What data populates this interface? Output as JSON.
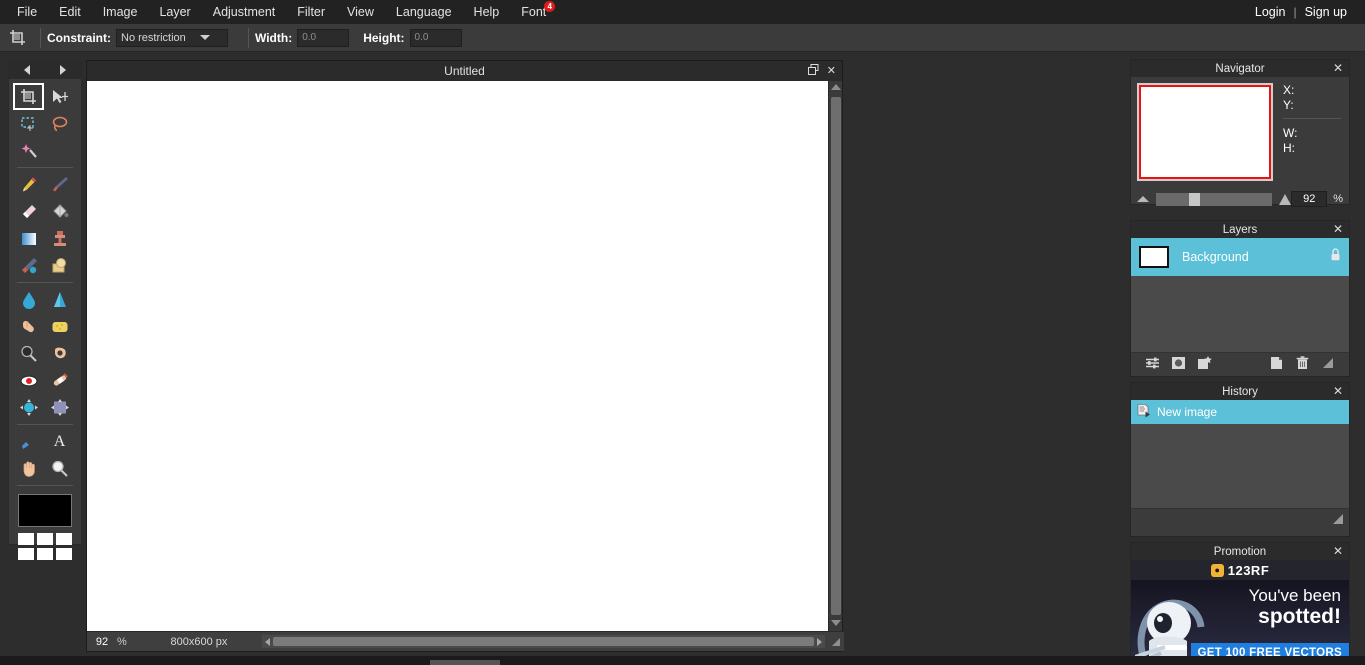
{
  "menubar": {
    "items": [
      {
        "label": "File"
      },
      {
        "label": "Edit"
      },
      {
        "label": "Image"
      },
      {
        "label": "Layer"
      },
      {
        "label": "Adjustment"
      },
      {
        "label": "Filter"
      },
      {
        "label": "View"
      },
      {
        "label": "Language"
      },
      {
        "label": "Help"
      },
      {
        "label": "Font",
        "badge": "4"
      }
    ],
    "login": "Login",
    "separator": "|",
    "signup": "Sign up"
  },
  "optionsbar": {
    "tool_icon": "crop-icon",
    "constraint_label": "Constraint:",
    "constraint_value": "No restriction",
    "width_label": "Width:",
    "width_value": "0.0",
    "height_label": "Height:",
    "height_value": "0.0"
  },
  "toolbar": {
    "prev_icon": "arrow-left-icon",
    "next_icon": "arrow-right-icon",
    "tools": [
      {
        "name": "crop-tool",
        "glyph": "⌗",
        "active": true
      },
      {
        "name": "move-tool",
        "glyph": "➤"
      },
      {
        "name": "marquee-select-tool",
        "glyph": "⬚"
      },
      {
        "name": "lasso-tool",
        "glyph": "◯"
      },
      {
        "name": "magic-wand-tool",
        "glyph": "✨"
      },
      {
        "name": "pencil-tool",
        "glyph": "✏"
      },
      {
        "name": "brush-tool",
        "glyph": "὘C"
      },
      {
        "name": "eraser-tool",
        "glyph": "▱"
      },
      {
        "name": "paint-bucket-tool",
        "glyph": "Ὗ3"
      },
      {
        "name": "gradient-tool",
        "glyph": "▤"
      },
      {
        "name": "clone-stamp-tool",
        "glyph": "⚓"
      },
      {
        "name": "color-replace-tool",
        "glyph": "὘D"
      },
      {
        "name": "drawing-tool",
        "glyph": "◳"
      },
      {
        "name": "blur-tool",
        "glyph": "Ὂ7"
      },
      {
        "name": "sharpen-tool",
        "glyph": "▲"
      },
      {
        "name": "smudge-tool",
        "glyph": "☝"
      },
      {
        "name": "sponge-tool",
        "glyph": "ᾟD"
      },
      {
        "name": "dodge-tool",
        "glyph": "ὐD"
      },
      {
        "name": "burn-tool",
        "glyph": "ὄC"
      },
      {
        "name": "red-eye-tool",
        "glyph": "ὄ1"
      },
      {
        "name": "spot-heal-tool",
        "glyph": "ᾧ9"
      },
      {
        "name": "bloat-tool",
        "glyph": "⬤"
      },
      {
        "name": "pinch-tool",
        "glyph": "◈"
      },
      {
        "name": "color-picker-tool",
        "glyph": "Ὀ9"
      },
      {
        "name": "type-tool",
        "glyph": "A"
      },
      {
        "name": "hand-tool",
        "glyph": "✋"
      },
      {
        "name": "zoom-tool",
        "glyph": "ὐE"
      }
    ],
    "foreground_color": "#000000",
    "swatch_color": "#ffffff",
    "swatch_count": 6
  },
  "canvas": {
    "title": "Untitled",
    "restore_icon": "restore-window-icon",
    "close_icon": "close-icon",
    "status": {
      "zoom": "92",
      "percent": "%",
      "dimensions": "800x600 px"
    }
  },
  "navigator": {
    "title": "Navigator",
    "close_icon": "close-icon",
    "x_label": "X:",
    "y_label": "Y:",
    "w_label": "W:",
    "h_label": "H:",
    "zoom_value": "92",
    "percent": "%",
    "viewport_color": "#ee1111"
  },
  "layers": {
    "title": "Layers",
    "close_icon": "close-icon",
    "rows": [
      {
        "name": "Background",
        "locked": true,
        "selected": true
      }
    ],
    "lock_icon": "lock-icon",
    "tools": [
      {
        "name": "layer-settings-icon",
        "glyph": "☲"
      },
      {
        "name": "layer-mask-icon",
        "glyph": "◉"
      },
      {
        "name": "add-layer-icon",
        "glyph": "✧"
      },
      {
        "name": "duplicate-layer-icon",
        "glyph": "❐"
      },
      {
        "name": "delete-layer-icon",
        "glyph": "Ὕ1"
      },
      {
        "name": "resize-grip-icon",
        "glyph": "◢"
      }
    ],
    "selection_color": "#5bc0d8"
  },
  "history": {
    "title": "History",
    "close_icon": "close-icon",
    "entries": [
      {
        "label": "New image",
        "icon": "new-image-icon",
        "selected": true
      }
    ],
    "resize_grip_icon": "resize-grip-icon"
  },
  "promotion": {
    "title": "Promotion",
    "close_icon": "close-icon",
    "brand": "123RF",
    "brand_mark_icon": "person-badge-icon",
    "headline_line1": "You've been",
    "headline_line2": "spotted!",
    "cta": "GET 100 FREE VECTORS",
    "cta_color": "#1f7fe0"
  }
}
